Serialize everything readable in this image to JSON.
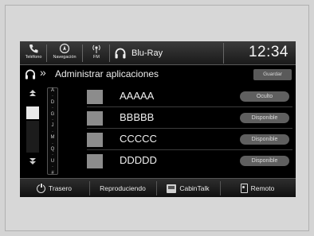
{
  "topbar": {
    "phone_label": "Teléfono",
    "nav_label": "Navegación",
    "fm_label": "FM",
    "source_label": "Blu-Ray",
    "clock": "12:34"
  },
  "titlebar": {
    "title": "Administrar aplicaciones",
    "save_label": "Guardar"
  },
  "index_letters": [
    "A",
    "·",
    "D",
    "·",
    "G",
    "·",
    "J",
    "·",
    "M",
    "·",
    "Q",
    "·",
    "U",
    "·",
    "#"
  ],
  "rows": [
    {
      "name": "AAAAA",
      "status": "Oculto"
    },
    {
      "name": "BBBBB",
      "status": "Disponible"
    },
    {
      "name": "CCCCC",
      "status": "Disponible"
    },
    {
      "name": "DDDDD",
      "status": "Disponible"
    }
  ],
  "bottombar": {
    "rear_label": "Trasero",
    "playing_label": "Reproduciendo",
    "cabintalk_label": "CabinTalk",
    "remote_label": "Remoto"
  },
  "icons": {
    "phone": "phone-icon",
    "nav": "navigation-icon",
    "fm": "radio-icon",
    "source": "headphones-icon",
    "title": "headphones-icon",
    "rear": "power-icon",
    "cabintalk": "cabintalk-icon",
    "remote": "remote-icon"
  }
}
